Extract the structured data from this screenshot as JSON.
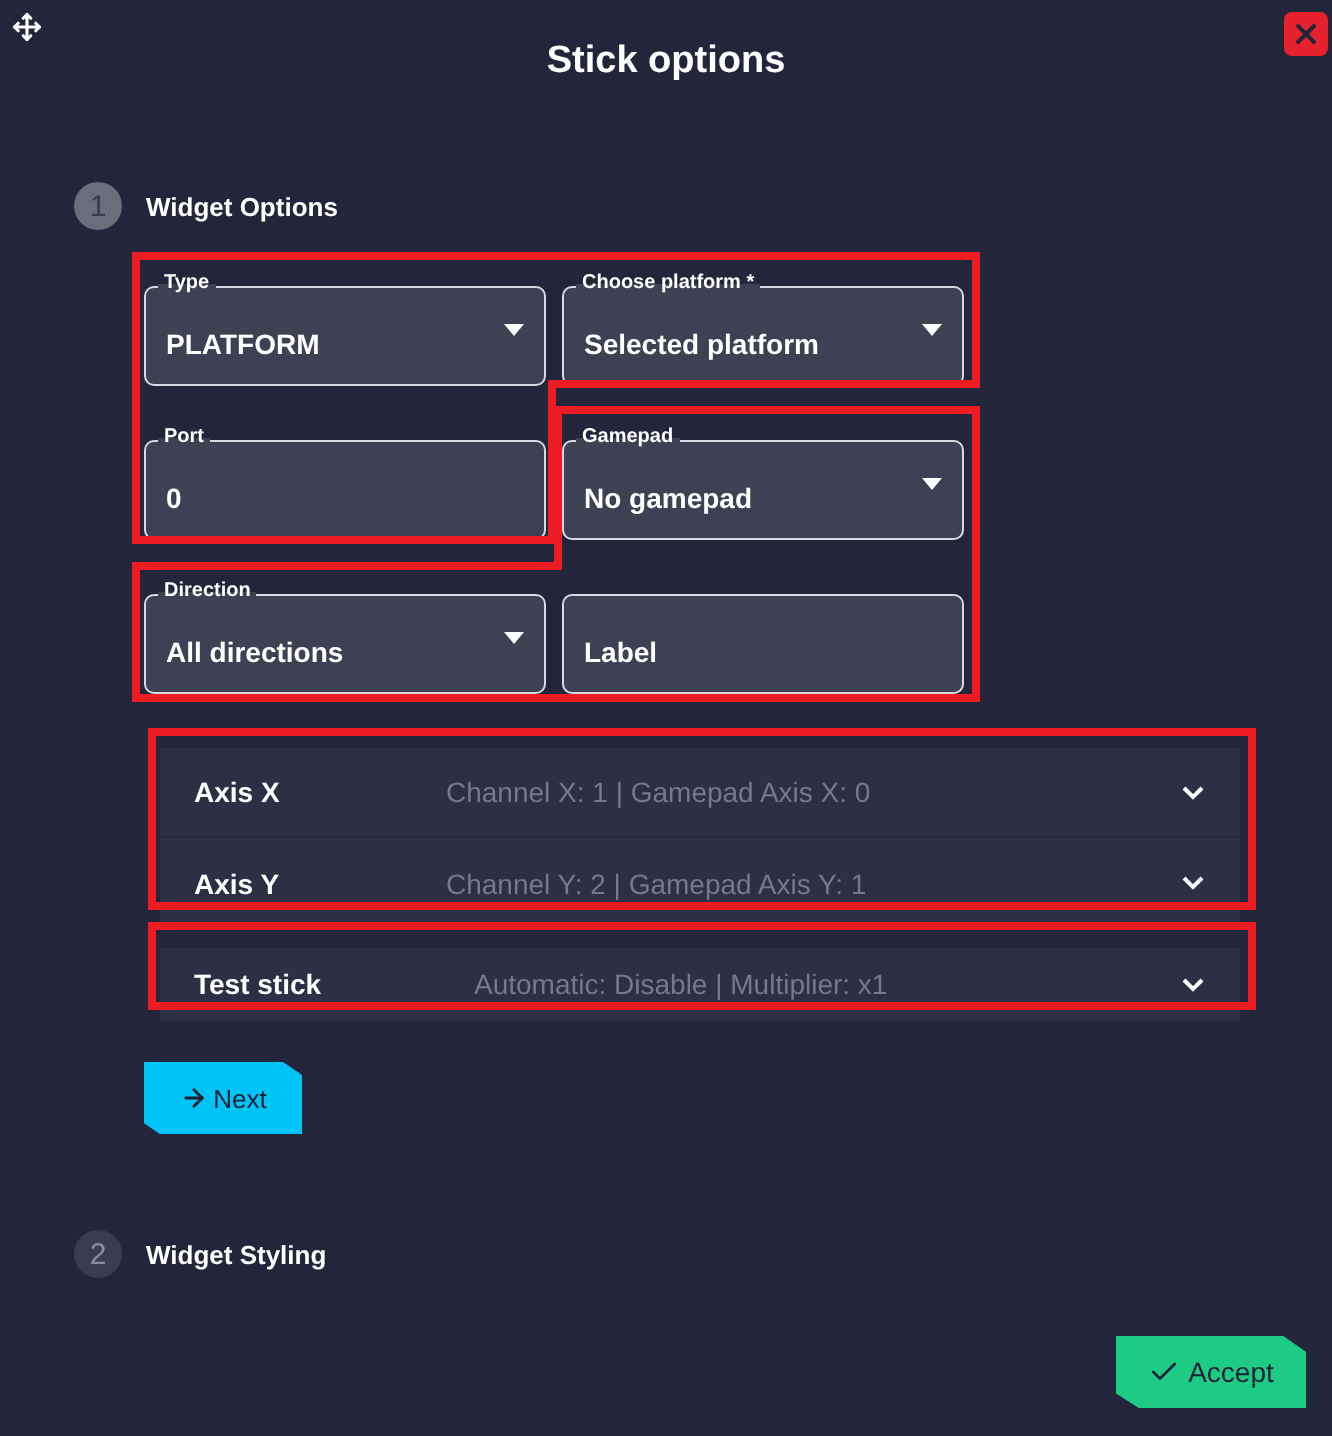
{
  "window": {
    "title": "Stick options"
  },
  "steps": [
    {
      "number": "1",
      "label": "Widget Options",
      "active": true
    },
    {
      "number": "2",
      "label": "Widget Styling",
      "active": false
    }
  ],
  "fields": [
    {
      "kind": "select",
      "label": "Type",
      "value": "PLATFORM"
    },
    {
      "kind": "select",
      "label": "Choose platform *",
      "value": "Selected platform"
    },
    {
      "kind": "text",
      "label": "Port",
      "value": "0"
    },
    {
      "kind": "select",
      "label": "Gamepad",
      "value": "No gamepad"
    },
    {
      "kind": "select",
      "label": "Direction",
      "value": "All directions"
    },
    {
      "kind": "text",
      "placeholder": "Label"
    }
  ],
  "axes": [
    {
      "title": "Axis X",
      "summary": "Channel X: 1 | Gamepad Axis X: 0",
      "expanded": false
    },
    {
      "title": "Axis Y",
      "summary": "Channel Y: 2 | Gamepad Axis Y: 1",
      "expanded": false
    }
  ],
  "test_stick": {
    "title": "Test stick",
    "summary": "Automatic: Disable | Multiplier: x1",
    "expanded": false
  },
  "next_button": "Next",
  "accept_button": "Accept"
}
